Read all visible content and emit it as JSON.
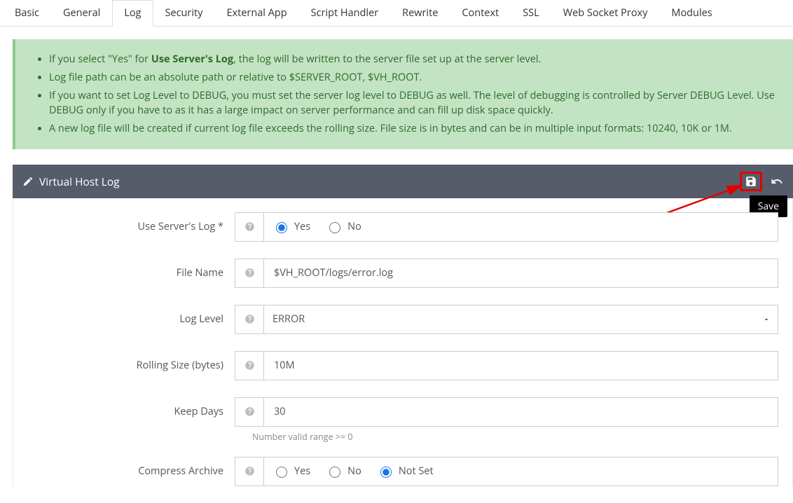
{
  "tabs": [
    "Basic",
    "General",
    "Log",
    "Security",
    "External App",
    "Script Handler",
    "Rewrite",
    "Context",
    "SSL",
    "Web Socket Proxy",
    "Modules"
  ],
  "active_tab": "Log",
  "info": {
    "bullets_pre": [
      "If you select \"Yes\" for "
    ],
    "use_server_log_bold": "Use Server's Log",
    "bullet1_post": ", the log will be written to the server file set up at the server level.",
    "bullet2": "Log file path can be an absolute path or relative to $SERVER_ROOT, $VH_ROOT.",
    "bullet3": "If you want to set Log Level to DEBUG, you must set the server log level to DEBUG as well. The level of debugging is controlled by Server DEBUG Level. Use DEBUG only if you have to as it has a large impact on server performance and can fill up disk space quickly.",
    "bullet4": "A new log file will be created if current log file exceeds the rolling size. File size is in bytes and can be in multiple input formats: 10240, 10K or 1M."
  },
  "panel": {
    "title": "Virtual Host Log",
    "save_tooltip": "Save"
  },
  "form": {
    "use_server_log": {
      "label": "Use Server's Log *",
      "options": [
        "Yes",
        "No"
      ],
      "value": "Yes"
    },
    "file_name": {
      "label": "File Name",
      "value": "$VH_ROOT/logs/error.log"
    },
    "log_level": {
      "label": "Log Level",
      "value": "ERROR"
    },
    "rolling_size": {
      "label": "Rolling Size (bytes)",
      "value": "10M"
    },
    "keep_days": {
      "label": "Keep Days",
      "value": "30",
      "hint": "Number valid range >= 0"
    },
    "compress_archive": {
      "label": "Compress Archive",
      "options": [
        "Yes",
        "No",
        "Not Set"
      ],
      "value": "Not Set"
    }
  }
}
